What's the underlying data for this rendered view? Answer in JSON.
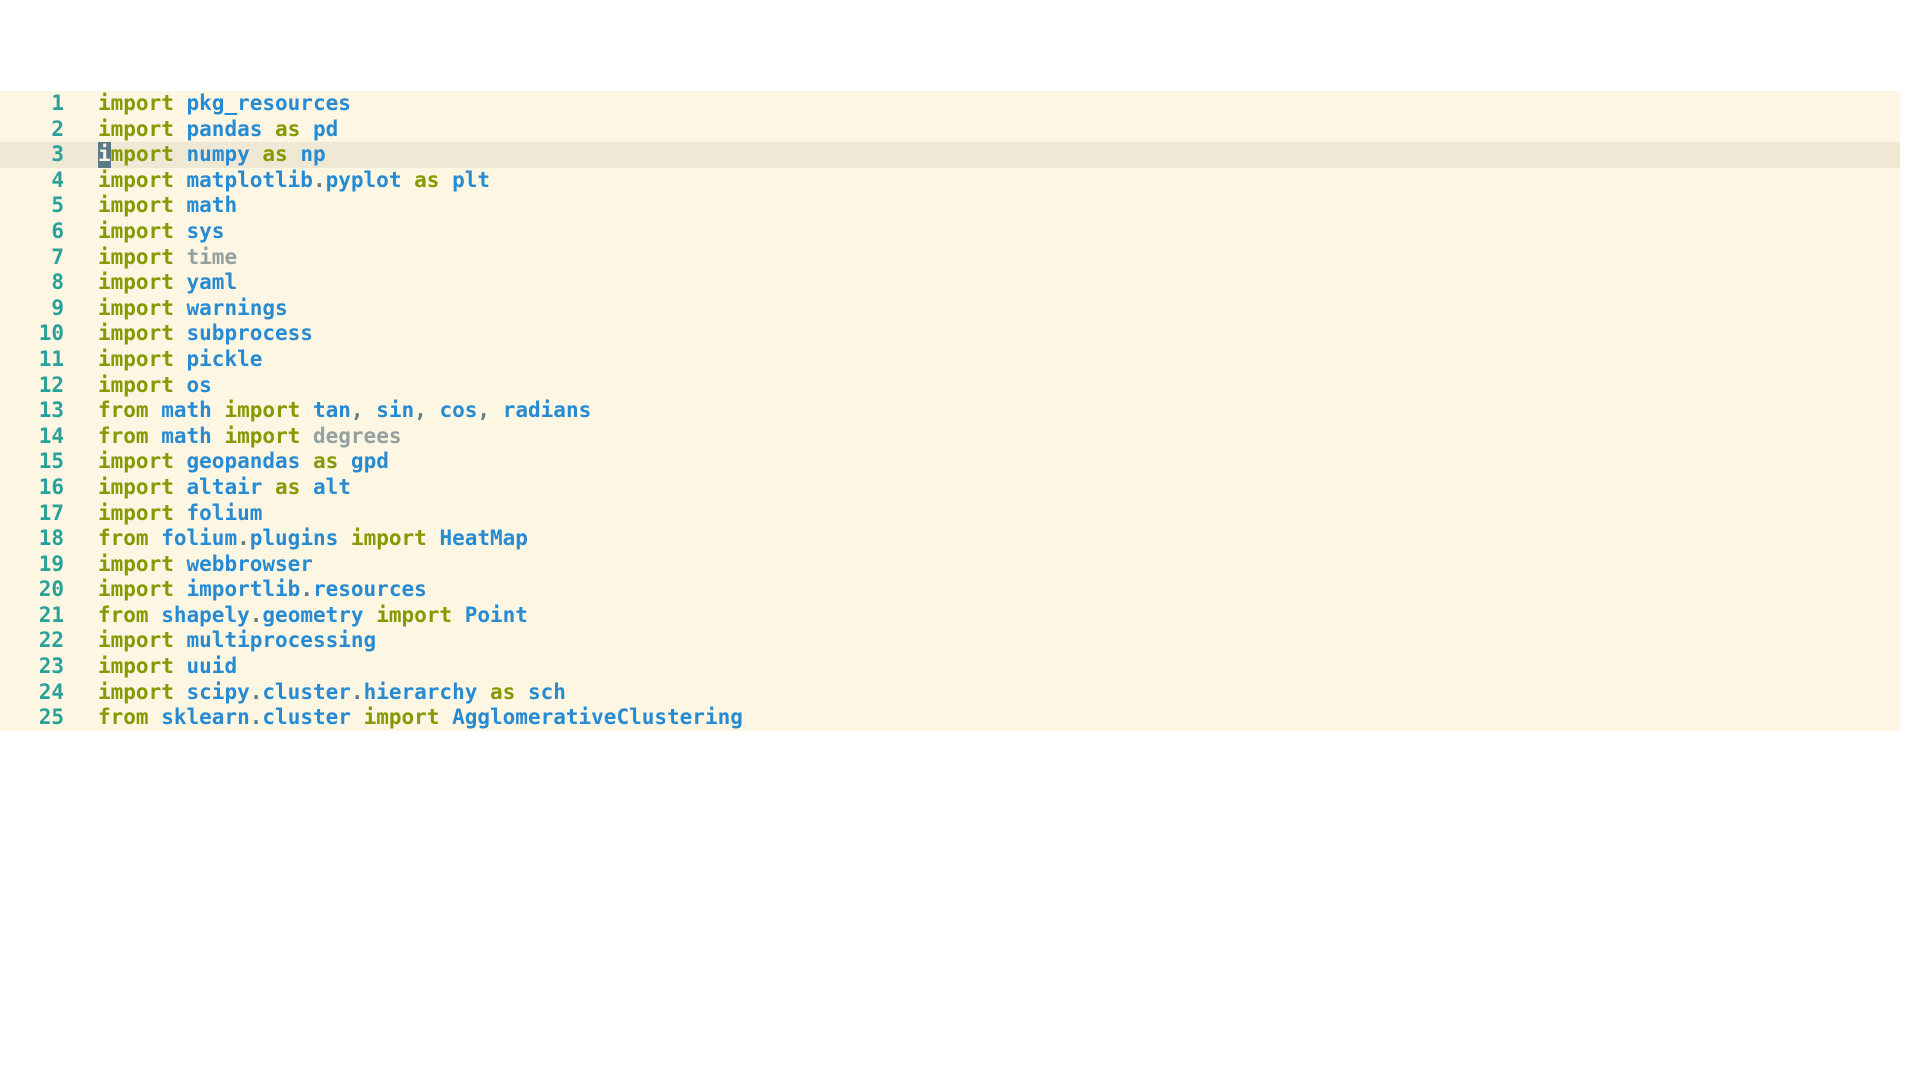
{
  "editor": {
    "highlighted_line": 3,
    "cursor_char": "i",
    "lines": [
      {
        "num": "1",
        "tokens": [
          {
            "t": "import",
            "c": "kw"
          },
          {
            "t": " "
          },
          {
            "t": "pkg_resources",
            "c": "mod"
          }
        ]
      },
      {
        "num": "2",
        "tokens": [
          {
            "t": "import",
            "c": "kw"
          },
          {
            "t": " "
          },
          {
            "t": "pandas",
            "c": "mod"
          },
          {
            "t": " "
          },
          {
            "t": "as",
            "c": "kw"
          },
          {
            "t": " "
          },
          {
            "t": "pd",
            "c": "mod"
          }
        ]
      },
      {
        "num": "3",
        "tokens": [
          {
            "t": "mport",
            "c": "kw"
          },
          {
            "t": " "
          },
          {
            "t": "numpy",
            "c": "mod"
          },
          {
            "t": " "
          },
          {
            "t": "as",
            "c": "kw"
          },
          {
            "t": " "
          },
          {
            "t": "np",
            "c": "mod"
          }
        ]
      },
      {
        "num": "4",
        "tokens": [
          {
            "t": "import",
            "c": "kw"
          },
          {
            "t": " "
          },
          {
            "t": "matplotlib",
            "c": "mod"
          },
          {
            "t": ".",
            "c": "punct"
          },
          {
            "t": "pyplot",
            "c": "mod"
          },
          {
            "t": " "
          },
          {
            "t": "as",
            "c": "kw"
          },
          {
            "t": " "
          },
          {
            "t": "plt",
            "c": "mod"
          }
        ]
      },
      {
        "num": "5",
        "tokens": [
          {
            "t": "import",
            "c": "kw"
          },
          {
            "t": " "
          },
          {
            "t": "math",
            "c": "mod"
          }
        ]
      },
      {
        "num": "6",
        "tokens": [
          {
            "t": "import",
            "c": "kw"
          },
          {
            "t": " "
          },
          {
            "t": "sys",
            "c": "mod"
          }
        ]
      },
      {
        "num": "7",
        "tokens": [
          {
            "t": "import",
            "c": "kw"
          },
          {
            "t": " "
          },
          {
            "t": "time",
            "c": "dim"
          }
        ]
      },
      {
        "num": "8",
        "tokens": [
          {
            "t": "import",
            "c": "kw"
          },
          {
            "t": " "
          },
          {
            "t": "yaml",
            "c": "mod"
          }
        ]
      },
      {
        "num": "9",
        "tokens": [
          {
            "t": "import",
            "c": "kw"
          },
          {
            "t": " "
          },
          {
            "t": "warnings",
            "c": "mod"
          }
        ]
      },
      {
        "num": "10",
        "tokens": [
          {
            "t": "import",
            "c": "kw"
          },
          {
            "t": " "
          },
          {
            "t": "subprocess",
            "c": "mod"
          }
        ]
      },
      {
        "num": "11",
        "tokens": [
          {
            "t": "import",
            "c": "kw"
          },
          {
            "t": " "
          },
          {
            "t": "pickle",
            "c": "mod"
          }
        ]
      },
      {
        "num": "12",
        "tokens": [
          {
            "t": "import",
            "c": "kw"
          },
          {
            "t": " "
          },
          {
            "t": "os",
            "c": "mod"
          }
        ]
      },
      {
        "num": "13",
        "tokens": [
          {
            "t": "from",
            "c": "kw"
          },
          {
            "t": " "
          },
          {
            "t": "math",
            "c": "mod"
          },
          {
            "t": " "
          },
          {
            "t": "import",
            "c": "kw"
          },
          {
            "t": " "
          },
          {
            "t": "tan",
            "c": "mod"
          },
          {
            "t": ",",
            "c": "punct"
          },
          {
            "t": " "
          },
          {
            "t": "sin",
            "c": "mod"
          },
          {
            "t": ",",
            "c": "punct"
          },
          {
            "t": " "
          },
          {
            "t": "cos",
            "c": "mod"
          },
          {
            "t": ",",
            "c": "punct"
          },
          {
            "t": " "
          },
          {
            "t": "radians",
            "c": "mod"
          }
        ]
      },
      {
        "num": "14",
        "tokens": [
          {
            "t": "from",
            "c": "kw"
          },
          {
            "t": " "
          },
          {
            "t": "math",
            "c": "mod"
          },
          {
            "t": " "
          },
          {
            "t": "import",
            "c": "kw"
          },
          {
            "t": " "
          },
          {
            "t": "degrees",
            "c": "dim"
          }
        ]
      },
      {
        "num": "15",
        "tokens": [
          {
            "t": "import",
            "c": "kw"
          },
          {
            "t": " "
          },
          {
            "t": "geopandas",
            "c": "mod"
          },
          {
            "t": " "
          },
          {
            "t": "as",
            "c": "kw"
          },
          {
            "t": " "
          },
          {
            "t": "gpd",
            "c": "mod"
          }
        ]
      },
      {
        "num": "16",
        "tokens": [
          {
            "t": "import",
            "c": "kw"
          },
          {
            "t": " "
          },
          {
            "t": "altair",
            "c": "mod"
          },
          {
            "t": " "
          },
          {
            "t": "as",
            "c": "kw"
          },
          {
            "t": " "
          },
          {
            "t": "alt",
            "c": "mod"
          }
        ]
      },
      {
        "num": "17",
        "tokens": [
          {
            "t": "import",
            "c": "kw"
          },
          {
            "t": " "
          },
          {
            "t": "folium",
            "c": "mod"
          }
        ]
      },
      {
        "num": "18",
        "tokens": [
          {
            "t": "from",
            "c": "kw"
          },
          {
            "t": " "
          },
          {
            "t": "folium",
            "c": "mod"
          },
          {
            "t": ".",
            "c": "punct"
          },
          {
            "t": "plugins",
            "c": "mod"
          },
          {
            "t": " "
          },
          {
            "t": "import",
            "c": "kw"
          },
          {
            "t": " "
          },
          {
            "t": "HeatMap",
            "c": "mod"
          }
        ]
      },
      {
        "num": "19",
        "tokens": [
          {
            "t": "import",
            "c": "kw"
          },
          {
            "t": " "
          },
          {
            "t": "webbrowser",
            "c": "mod"
          }
        ]
      },
      {
        "num": "20",
        "tokens": [
          {
            "t": "import",
            "c": "kw"
          },
          {
            "t": " "
          },
          {
            "t": "importlib",
            "c": "mod"
          },
          {
            "t": ".",
            "c": "punct"
          },
          {
            "t": "resources",
            "c": "mod"
          }
        ]
      },
      {
        "num": "21",
        "tokens": [
          {
            "t": "from",
            "c": "kw"
          },
          {
            "t": " "
          },
          {
            "t": "shapely",
            "c": "mod"
          },
          {
            "t": ".",
            "c": "punct"
          },
          {
            "t": "geometry",
            "c": "mod"
          },
          {
            "t": " "
          },
          {
            "t": "import",
            "c": "kw"
          },
          {
            "t": " "
          },
          {
            "t": "Point",
            "c": "mod"
          }
        ]
      },
      {
        "num": "22",
        "tokens": [
          {
            "t": "import",
            "c": "kw"
          },
          {
            "t": " "
          },
          {
            "t": "multiprocessing",
            "c": "mod"
          }
        ]
      },
      {
        "num": "23",
        "tokens": [
          {
            "t": "import",
            "c": "kw"
          },
          {
            "t": " "
          },
          {
            "t": "uuid",
            "c": "mod"
          }
        ]
      },
      {
        "num": "24",
        "tokens": [
          {
            "t": "import",
            "c": "kw"
          },
          {
            "t": " "
          },
          {
            "t": "scipy",
            "c": "mod"
          },
          {
            "t": ".",
            "c": "punct"
          },
          {
            "t": "cluster",
            "c": "mod"
          },
          {
            "t": ".",
            "c": "punct"
          },
          {
            "t": "hierarchy",
            "c": "mod"
          },
          {
            "t": " "
          },
          {
            "t": "as",
            "c": "kw"
          },
          {
            "t": " "
          },
          {
            "t": "sch",
            "c": "mod"
          }
        ]
      },
      {
        "num": "25",
        "tokens": [
          {
            "t": "from",
            "c": "kw"
          },
          {
            "t": " "
          },
          {
            "t": "sklearn",
            "c": "mod"
          },
          {
            "t": ".",
            "c": "punct"
          },
          {
            "t": "cluster",
            "c": "mod"
          },
          {
            "t": " "
          },
          {
            "t": "import",
            "c": "kw"
          },
          {
            "t": " "
          },
          {
            "t": "AgglomerativeClustering",
            "c": "mod"
          }
        ]
      }
    ]
  }
}
